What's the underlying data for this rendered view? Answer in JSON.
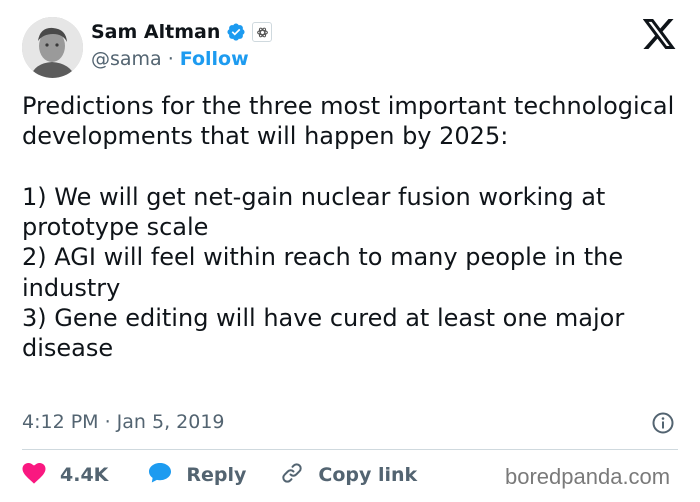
{
  "author": {
    "display_name": "Sam Altman",
    "handle": "@sama",
    "separator": "·",
    "follow_label": "Follow"
  },
  "tweet": {
    "text": "Predictions for the three most important technological developments that will happen by 2025:\n\n1) We will get net-gain nuclear fusion working at prototype scale\n2) AGI will feel within reach to many people in the industry\n3) Gene editing will have cured at least one major disease",
    "timestamp": "4:12 PM · Jan 5, 2019"
  },
  "actions": {
    "likes_count": "4.4K",
    "reply_label": "Reply",
    "copy_link_label": "Copy link"
  },
  "watermark": "boredpanda.com",
  "icons": {
    "verified": "verified-check-icon",
    "affiliate": "openai-logo-icon",
    "brand": "x-logo-icon",
    "info": "info-icon",
    "like": "heart-icon",
    "reply": "speech-bubble-icon",
    "copy_link": "link-icon"
  },
  "colors": {
    "accent": "#1d9bf0",
    "like": "#f91880",
    "text": "#0f1419",
    "muted": "#536471"
  }
}
